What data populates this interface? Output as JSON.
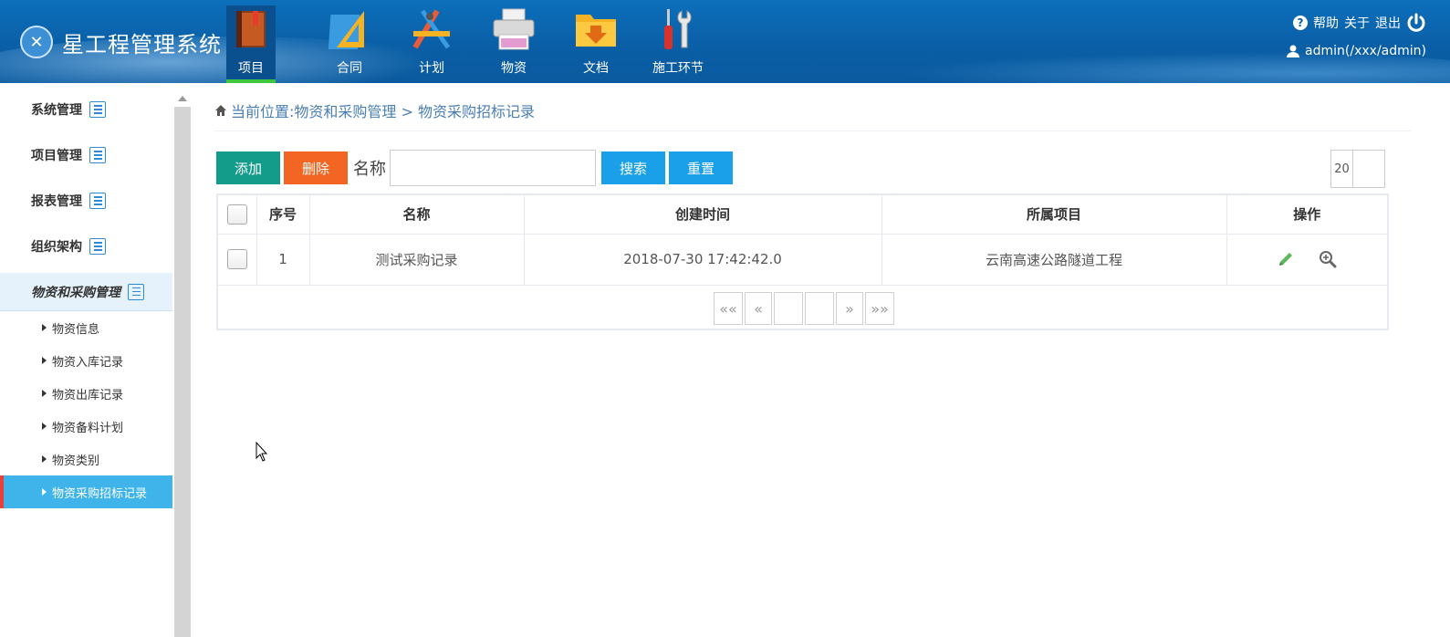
{
  "app": {
    "title": "星工程管理系统"
  },
  "topnav": [
    {
      "label": "项目",
      "icon": "book-icon"
    },
    {
      "label": "合同",
      "icon": "ruler-triangle-icon"
    },
    {
      "label": "计划",
      "icon": "drafting-tools-icon"
    },
    {
      "label": "物资",
      "icon": "printer-icon"
    },
    {
      "label": "文档",
      "icon": "folder-download-icon"
    },
    {
      "label": "施工环节",
      "icon": "screwdriver-wrench-icon"
    }
  ],
  "userarea": {
    "help": "帮助",
    "about": "关于",
    "logout": "退出",
    "user": "admin(/xxx/admin)"
  },
  "sidebar": {
    "groups": [
      "系统管理",
      "项目管理",
      "报表管理",
      "组织架构",
      "物资和采购管理"
    ],
    "sub_items": [
      "物资信息",
      "物资入库记录",
      "物资出库记录",
      "物资备料计划",
      "物资类别",
      "物资采购招标记录"
    ]
  },
  "breadcrumb": "当前位置:物资和采购管理 > 物资采购招标记录",
  "toolbar": {
    "add": "添加",
    "delete": "删除",
    "name_label": "名称",
    "name_value": "",
    "search": "搜索",
    "reset": "重置",
    "page_size": "20"
  },
  "table": {
    "headers": [
      "序号",
      "名称",
      "创建时间",
      "所属项目",
      "操作"
    ],
    "rows": [
      {
        "index": "1",
        "name": "测试采购记录",
        "created": "2018-07-30 17:42:42.0",
        "project": "云南高速公路隧道工程"
      }
    ]
  },
  "pager": {
    "first": "««",
    "prev": "«",
    "next": "»",
    "last": "»»"
  },
  "colors": {
    "header_bg": "#0b5fa6",
    "add_btn": "#139c8a",
    "delete_btn": "#f26522",
    "blue_btn": "#1aa0e8",
    "active_menu": "#3fb4ea"
  }
}
